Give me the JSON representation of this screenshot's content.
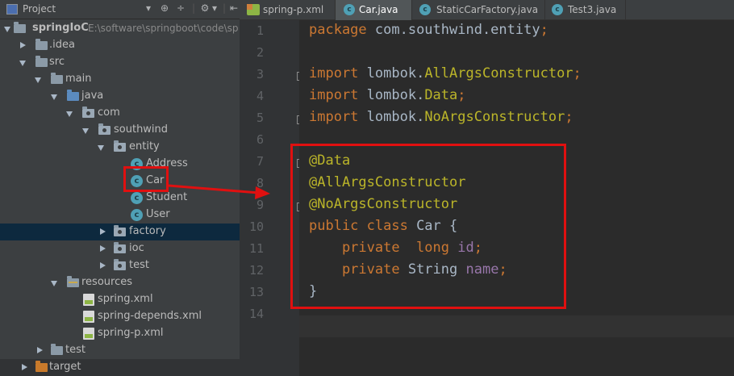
{
  "project_panel": {
    "title": "Project",
    "tools": [
      "▾",
      "⊕",
      "÷",
      "|",
      "⚙",
      "▾",
      "|",
      "⇤"
    ],
    "tree": [
      {
        "label": "springIoC",
        "path": "E:\\software\\springboot\\code\\sp",
        "icon": "module-folder-icon",
        "expanded": true
      },
      {
        "label": ".idea",
        "icon": "folder-icon",
        "expanded": false
      },
      {
        "label": "src",
        "icon": "folder-icon",
        "expanded": true
      },
      {
        "label": "main",
        "icon": "folder-icon",
        "expanded": true
      },
      {
        "label": "java",
        "icon": "source-folder-icon",
        "expanded": true
      },
      {
        "label": "com",
        "icon": "package-icon",
        "expanded": true
      },
      {
        "label": "southwind",
        "icon": "package-icon",
        "expanded": true
      },
      {
        "label": "entity",
        "icon": "package-icon",
        "expanded": true
      },
      {
        "label": "Address",
        "icon": "class-icon"
      },
      {
        "label": "Car",
        "icon": "class-icon"
      },
      {
        "label": "Student",
        "icon": "class-icon"
      },
      {
        "label": "User",
        "icon": "class-icon"
      },
      {
        "label": "factory",
        "icon": "package-icon",
        "expanded": false,
        "selected": true
      },
      {
        "label": "ioc",
        "icon": "package-icon",
        "expanded": false
      },
      {
        "label": "test",
        "icon": "package-icon",
        "expanded": false
      },
      {
        "label": "resources",
        "icon": "resources-folder-icon",
        "expanded": true
      },
      {
        "label": "spring.xml",
        "icon": "xml-file-icon"
      },
      {
        "label": "spring-depends.xml",
        "icon": "xml-file-icon"
      },
      {
        "label": "spring-p.xml",
        "icon": "xml-file-icon"
      },
      {
        "label": "test",
        "icon": "folder-icon",
        "expanded": false
      },
      {
        "label": "target",
        "icon": "excluded-folder-icon",
        "expanded": false
      }
    ]
  },
  "tabs": [
    {
      "label": "spring-p.xml",
      "icon": "xml-file-icon",
      "active": false
    },
    {
      "label": "Car.java",
      "icon": "class-icon",
      "active": true
    },
    {
      "label": "StaticCarFactory.java",
      "icon": "class-icon",
      "active": false
    },
    {
      "label": "Test3.java",
      "icon": "class-icon",
      "active": false
    }
  ],
  "editor": {
    "line_numbers": [
      "1",
      "2",
      "3",
      "4",
      "5",
      "6",
      "7",
      "8",
      "9",
      "10",
      "11",
      "12",
      "13",
      "14"
    ],
    "lines": [
      [
        {
          "t": "package",
          "c": "kw"
        },
        {
          "t": " com.southwind.entity",
          "c": "plain"
        },
        {
          "t": ";",
          "c": "kw"
        }
      ],
      [],
      [
        {
          "t": "import",
          "c": "kw"
        },
        {
          "t": " lombok.",
          "c": "plain"
        },
        {
          "t": "AllArgsConstructor",
          "c": "ann"
        },
        {
          "t": ";",
          "c": "kw"
        }
      ],
      [
        {
          "t": "import",
          "c": "kw"
        },
        {
          "t": " lombok.",
          "c": "plain"
        },
        {
          "t": "Data",
          "c": "ann"
        },
        {
          "t": ";",
          "c": "kw"
        }
      ],
      [
        {
          "t": "import",
          "c": "kw"
        },
        {
          "t": " lombok.",
          "c": "plain"
        },
        {
          "t": "NoArgsConstructor",
          "c": "ann"
        },
        {
          "t": ";",
          "c": "kw"
        }
      ],
      [],
      [
        {
          "t": "@Data",
          "c": "ann"
        }
      ],
      [
        {
          "t": "@AllArgsConstructor",
          "c": "ann"
        }
      ],
      [
        {
          "t": "@NoArgsConstructor",
          "c": "ann"
        }
      ],
      [
        {
          "t": "public class",
          "c": "kw"
        },
        {
          "t": " Car {",
          "c": "plain"
        }
      ],
      [
        {
          "t": "    private  long",
          "c": "kw"
        },
        {
          "t": " ",
          "c": "plain"
        },
        {
          "t": "id",
          "c": "fld"
        },
        {
          "t": ";",
          "c": "kw"
        }
      ],
      [
        {
          "t": "    private",
          "c": "kw"
        },
        {
          "t": " String ",
          "c": "plain"
        },
        {
          "t": "name",
          "c": "fld"
        },
        {
          "t": ";",
          "c": "kw"
        }
      ],
      [
        {
          "t": "}",
          "c": "plain"
        }
      ],
      []
    ]
  },
  "colors": {
    "highlight_box": "#e01010",
    "keyword": "#cc7832",
    "annotation": "#bbb529",
    "field": "#9876aa",
    "text": "#a9b7c6"
  }
}
